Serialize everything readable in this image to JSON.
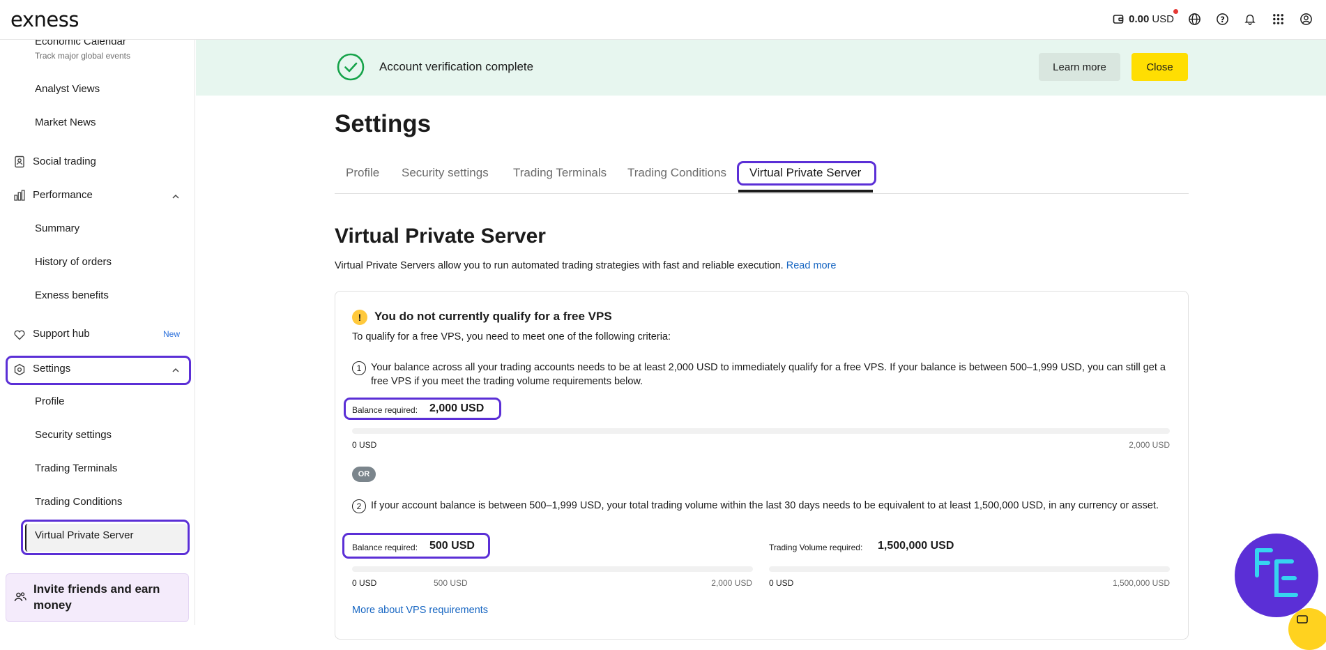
{
  "header": {
    "logo": "exness",
    "balance_amount": "0.00",
    "balance_currency": "USD"
  },
  "sidebar": {
    "items": [
      {
        "label": "Economic Calendar",
        "sublabel": "Track major global events"
      },
      {
        "label": "Analyst Views"
      },
      {
        "label": "Market News"
      },
      {
        "label": "Social trading"
      },
      {
        "label": "Performance"
      },
      {
        "label": "Summary"
      },
      {
        "label": "History of orders"
      },
      {
        "label": "Exness benefits"
      },
      {
        "label": "Support hub",
        "badge": "New"
      },
      {
        "label": "Settings"
      },
      {
        "label": "Profile"
      },
      {
        "label": "Security settings"
      },
      {
        "label": "Trading Terminals"
      },
      {
        "label": "Trading Conditions"
      },
      {
        "label": "Virtual Private Server"
      }
    ],
    "invite": "Invite friends and earn money"
  },
  "banner": {
    "text": "Account verification complete",
    "learn_more": "Learn more",
    "close": "Close"
  },
  "main": {
    "title": "Settings",
    "tabs": [
      {
        "label": "Profile"
      },
      {
        "label": "Security settings"
      },
      {
        "label": "Trading Terminals"
      },
      {
        "label": "Trading Conditions"
      },
      {
        "label": "Virtual Private Server"
      }
    ],
    "section_title": "Virtual Private Server",
    "intro": "Virtual Private Servers allow you to run automated trading strategies with fast and reliable execution.",
    "read_more": "Read more",
    "card": {
      "title": "You do not currently qualify for a free VPS",
      "subtitle": "To qualify for a free VPS, you need to meet one of the following criteria:",
      "criterion1": {
        "number": "1",
        "text": "Your balance across all your trading accounts needs to be at least 2,000 USD to immediately qualify for a free VPS. If your balance is between 500–1,999 USD, you can still get a free VPS if you meet the trading volume requirements below.",
        "req_label": "Balance required:",
        "req_value": "2,000 USD",
        "progress": 0,
        "min": "0 USD",
        "max": "2,000 USD"
      },
      "or": "OR",
      "criterion2": {
        "number": "2",
        "text": "If your account balance is between 500–1,999 USD, your total trading volume within the last 30 days needs to be equivalent to at least 1,500,000 USD, in any currency or asset.",
        "balance_label": "Balance required:",
        "balance_value": "500 USD",
        "balance_progress": 0,
        "balance_min": "0 USD",
        "balance_mid": "500 USD",
        "balance_max": "2,000 USD",
        "volume_label": "Trading Volume required:",
        "volume_value": "1,500,000 USD",
        "volume_progress": 0,
        "volume_min": "0 USD",
        "volume_max": "1,500,000 USD"
      },
      "more_link": "More about VPS requirements"
    }
  },
  "colors": {
    "highlight": "#5b2fd6",
    "banner_bg": "#e7f6ef",
    "close_button": "#ffde02",
    "link": "#1766c2"
  }
}
